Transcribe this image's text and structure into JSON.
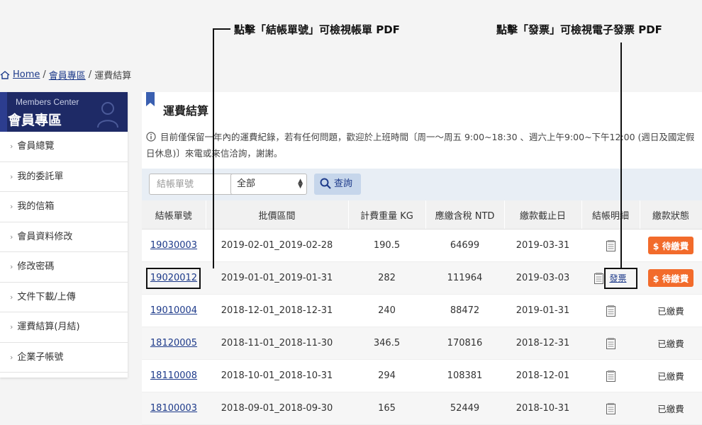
{
  "annotations": {
    "invoice_no_hint": "點擊「結帳單號」可檢視帳單 PDF",
    "receipt_hint": "點擊「發票」可檢視電子發票 PDF"
  },
  "breadcrumb": {
    "home": "Home",
    "member_area": "會員專區",
    "current": "運費結算",
    "sep": "/"
  },
  "sidebar": {
    "header_en": "Members Center",
    "header_zh": "會員專區",
    "items": [
      {
        "label": "會員總覽"
      },
      {
        "label": "我的委託單"
      },
      {
        "label": "我的信箱"
      },
      {
        "label": "會員資料修改"
      },
      {
        "label": "修改密碼"
      },
      {
        "label": "文件下載/上傳"
      },
      {
        "label": "運費結算(月結)"
      },
      {
        "label": "企業子帳號"
      }
    ]
  },
  "main": {
    "title": "運費結算",
    "notice": "目前僅保留一年內的運費紀錄，若有任何問題，歡迎於上班時間〔周一～周五 9:00~18:30 、週六上午9:00~下午12:00 (週日及國定假日休息)〕來電或來信洽詢，謝謝。"
  },
  "filter": {
    "placeholder": "結帳單號",
    "select_value": "全部",
    "search_label": "查詢"
  },
  "table": {
    "headers": [
      "結帳單號",
      "批價區間",
      "計費重量 KG",
      "應繳含稅 NTD",
      "繳款截止日",
      "結帳明細",
      "繳款狀態"
    ],
    "invoice_link_label": "發票",
    "pay_label": "$ 待繳費",
    "paid_label": "已繳費",
    "rows": [
      {
        "no": "19030003",
        "period": "2019-02-01_2019-02-28",
        "weight": "190.5",
        "amount": "64699",
        "due": "2019-03-31",
        "status": "待繳費"
      },
      {
        "no": "19020012",
        "period": "2019-01-01_2019-01-31",
        "weight": "282",
        "amount": "111964",
        "due": "2019-03-03",
        "status": "待繳費"
      },
      {
        "no": "19010004",
        "period": "2018-12-01_2018-12-31",
        "weight": "240",
        "amount": "88472",
        "due": "2019-01-31",
        "status": "已繳費"
      },
      {
        "no": "18120005",
        "period": "2018-11-01_2018-11-30",
        "weight": "346.5",
        "amount": "170816",
        "due": "2018-12-31",
        "status": "已繳費"
      },
      {
        "no": "18110008",
        "period": "2018-10-01_2018-10-31",
        "weight": "294",
        "amount": "108381",
        "due": "2018-12-01",
        "status": "已繳費"
      },
      {
        "no": "18100003",
        "period": "2018-09-01_2018-09-30",
        "weight": "165",
        "amount": "52449",
        "due": "2018-10-31",
        "status": "已繳費"
      }
    ]
  },
  "colors": {
    "brand_navy": "#1e2a66",
    "pay_orange": "#f26b2b",
    "link_blue": "#1d3a8a",
    "filter_bg": "#e8eef5"
  },
  "icons": [
    "home-icon",
    "user-silhouette-icon",
    "bookmark-icon",
    "info-icon",
    "search-icon",
    "document-icon",
    "chevron-right-icon",
    "chevron-updown-icon"
  ]
}
